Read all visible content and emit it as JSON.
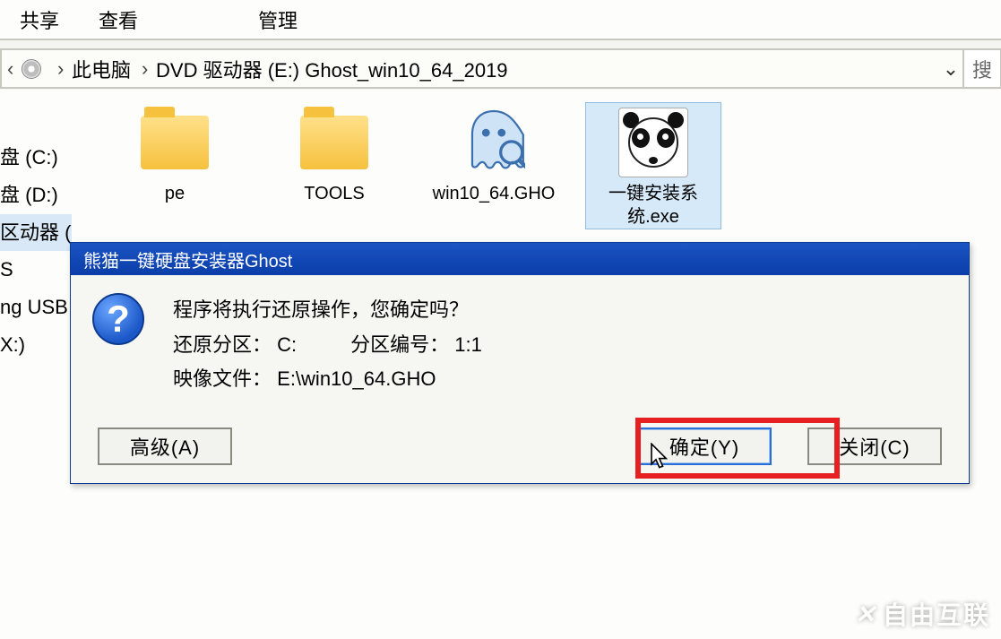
{
  "ribbon": {
    "share": "共享",
    "view": "查看",
    "manage": "管理"
  },
  "breadcrumb": {
    "pc": "此电脑",
    "drive": "DVD 驱动器 (E:) Ghost_win10_64_2019"
  },
  "search_placeholder": "搜",
  "sidebar": {
    "items": [
      "盘 (C:)",
      "盘 (D:)",
      "区动器 (E:) Gh",
      "",
      "S",
      "ng USB",
      "X:)"
    ]
  },
  "files": [
    {
      "name": "pe",
      "type": "folder"
    },
    {
      "name": "TOOLS",
      "type": "folder"
    },
    {
      "name": "win10_64.GHO",
      "type": "gho"
    },
    {
      "name": "一键安装系统.exe",
      "type": "panda",
      "selected": true
    }
  ],
  "dialog": {
    "title": "熊猫一键硬盘安装器Ghost",
    "message": "程序将执行还原操作，您确定吗？",
    "partition_label": "还原分区：",
    "partition_value": "C:",
    "partnum_label": "分区编号：",
    "partnum_value": "1:1",
    "image_label": "映像文件：",
    "image_value": "E:\\win10_64.GHO",
    "btn_advanced": "高级(A)",
    "btn_ok": "确定(Y)",
    "btn_close": "关闭(C)"
  },
  "watermark": "自由互联"
}
